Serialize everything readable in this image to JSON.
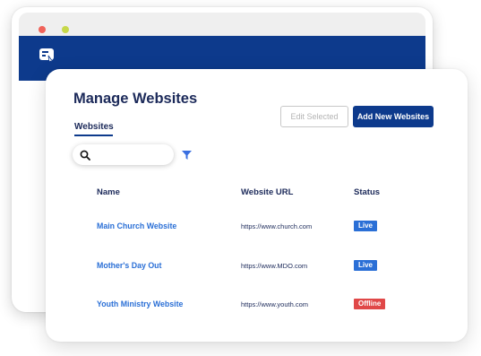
{
  "page": {
    "title": "Manage Websites",
    "tab": "Websites",
    "edit_button": "Edit Selected",
    "add_button": "Add New Websites",
    "search_placeholder": ""
  },
  "table": {
    "columns": [
      "Name",
      "Website URL",
      "Status"
    ],
    "rows": [
      {
        "name": "Main Church Website",
        "url": "https://www.church.com",
        "status": "Live"
      },
      {
        "name": "Mother's Day Out",
        "url": "https://www.MDO.com",
        "status": "Live"
      },
      {
        "name": "Youth Ministry Website",
        "url": "https://www.youth.com",
        "status": "Offline"
      }
    ]
  },
  "colors": {
    "navbar": "#0d3a8c",
    "live": "#2a6fd6",
    "offline": "#e04848"
  },
  "icons": [
    "app-logo-icon",
    "search-icon",
    "filter-icon"
  ]
}
